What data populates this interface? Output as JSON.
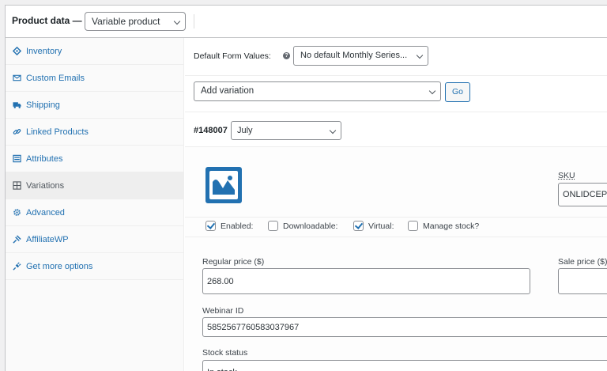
{
  "header": {
    "label": "Product data —",
    "product_type": "Variable product"
  },
  "sidebar": {
    "items": [
      {
        "label": "Inventory",
        "icon": "inventory-icon"
      },
      {
        "label": "Custom Emails",
        "icon": "envelope-icon"
      },
      {
        "label": "Shipping",
        "icon": "truck-icon"
      },
      {
        "label": "Linked Products",
        "icon": "link-icon"
      },
      {
        "label": "Attributes",
        "icon": "list-icon"
      },
      {
        "label": "Variations",
        "icon": "grid-icon",
        "active": true
      },
      {
        "label": "Advanced",
        "icon": "gear-icon"
      },
      {
        "label": "AffiliateWP",
        "icon": "affiliate-icon"
      },
      {
        "label": "Get more options",
        "icon": "plug-icon"
      }
    ]
  },
  "default_form": {
    "label": "Default Form Values:",
    "help": "?",
    "value": "No default Monthly Series..."
  },
  "add_variation": {
    "value": "Add variation",
    "go_label": "Go"
  },
  "variation": {
    "id": "#148007",
    "month": "July",
    "sku_label": "SKU",
    "sku_value": "ONLIDCEPG",
    "checkboxes": [
      {
        "label": "Enabled:",
        "checked": true
      },
      {
        "label": "Downloadable:",
        "checked": false
      },
      {
        "label": "Virtual:",
        "checked": true
      },
      {
        "label": "Manage stock?",
        "checked": false
      }
    ],
    "regular_price_label": "Regular price ($)",
    "regular_price": "268.00",
    "sale_price_label": "Sale price ($)",
    "sale_price": "",
    "webinar_label": "Webinar ID",
    "webinar_id": "5852567760583037967",
    "stock_label": "Stock status",
    "stock_value": "In stock"
  }
}
